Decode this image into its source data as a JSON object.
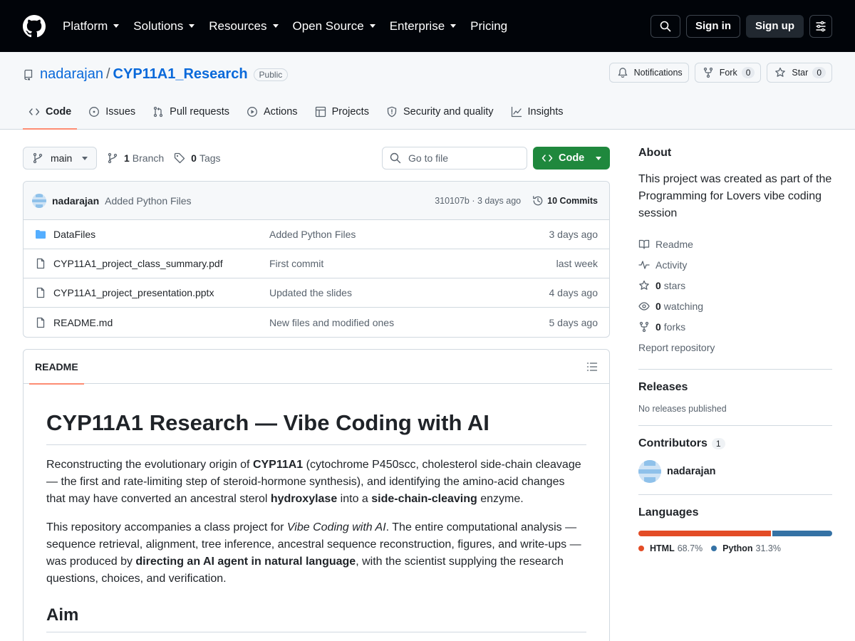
{
  "colors": {
    "accent_link": "#0969da",
    "header_bg": "#010409",
    "code_button": "#1f883d",
    "tab_underline": "#fd8c73",
    "html_lang": "#e34c26",
    "python_lang": "#3572A5"
  },
  "header": {
    "nav": [
      "Platform",
      "Solutions",
      "Resources",
      "Open Source",
      "Enterprise",
      "Pricing"
    ],
    "nav_dropdown": [
      true,
      true,
      true,
      true,
      true,
      false
    ],
    "signin": "Sign in",
    "signup": "Sign up"
  },
  "repo": {
    "owner": "nadarajan",
    "separator": "/",
    "name": "CYP11A1_Research",
    "visibility": "Public",
    "notifications_label": "Notifications",
    "fork_label": "Fork",
    "fork_count": "0",
    "star_label": "Star",
    "star_count": "0"
  },
  "tabs": [
    {
      "label": "Code",
      "icon": "code-icon"
    },
    {
      "label": "Issues",
      "icon": "issue-icon"
    },
    {
      "label": "Pull requests",
      "icon": "pull-request-icon"
    },
    {
      "label": "Actions",
      "icon": "play-icon"
    },
    {
      "label": "Projects",
      "icon": "table-icon"
    },
    {
      "label": "Security and quality",
      "icon": "shield-icon"
    },
    {
      "label": "Insights",
      "icon": "graph-icon"
    }
  ],
  "filebar": {
    "branch": "main",
    "branch_count": "1",
    "branch_label": "Branch",
    "tag_count": "0",
    "tag_label": "Tags",
    "goto_placeholder": "Go to file",
    "code_label": "Code"
  },
  "commit": {
    "author": "nadarajan",
    "message": "Added Python Files",
    "meta": "310107b · 3 days ago",
    "commits_label": "10 Commits"
  },
  "files": [
    {
      "type": "folder",
      "name": "DataFiles",
      "message": "Added Python Files",
      "date": "3 days ago"
    },
    {
      "type": "file",
      "name": "CYP11A1_project_class_summary.pdf",
      "message": "First commit",
      "date": "last week"
    },
    {
      "type": "file",
      "name": "CYP11A1_project_presentation.pptx",
      "message": "Updated the slides",
      "date": "4 days ago"
    },
    {
      "type": "file",
      "name": "README.md",
      "message": "New files and modified ones",
      "date": "5 days ago"
    }
  ],
  "readme": {
    "tab_label": "README",
    "title": "CYP11A1 Research — Vibe Coding with AI",
    "p1": {
      "a": "Reconstructing the evolutionary origin of ",
      "b": "CYP11A1",
      "c": " (cytochrome P450scc, cholesterol side-chain cleavage — the first and rate-limiting step of steroid-hormone synthesis), and identifying the amino-acid changes that may have converted an ancestral sterol ",
      "d": "hydroxylase",
      "e": " into a ",
      "f": "side-chain-cleaving",
      "g": " enzyme."
    },
    "p2": {
      "a": "This repository accompanies a class project for ",
      "b": "Vibe Coding with AI",
      "c": ". The entire computational analysis — sequence retrieval, alignment, tree inference, ancestral sequence reconstruction, figures, and write-ups — was produced by ",
      "d": "directing an AI agent in natural language",
      "e": ", with the scientist supplying the research questions, choices, and verification."
    },
    "h2": "Aim"
  },
  "about": {
    "title": "About",
    "description": "This project was created as part of the Programming for Lovers vibe coding session",
    "readme": "Readme",
    "activity": "Activity",
    "stars_count": "0",
    "stars_label": "stars",
    "watching_count": "0",
    "watching_label": "watching",
    "forks_count": "0",
    "forks_label": "forks",
    "report": "Report repository"
  },
  "releases": {
    "title": "Releases",
    "empty": "No releases published"
  },
  "contributors": {
    "title": "Contributors",
    "count": "1",
    "name": "nadarajan"
  },
  "languages": {
    "title": "Languages",
    "items": [
      {
        "name": "HTML",
        "percent": "68.7%",
        "value": 68.7,
        "color": "#e34c26"
      },
      {
        "name": "Python",
        "percent": "31.3%",
        "value": 31.3,
        "color": "#3572A5"
      }
    ]
  }
}
